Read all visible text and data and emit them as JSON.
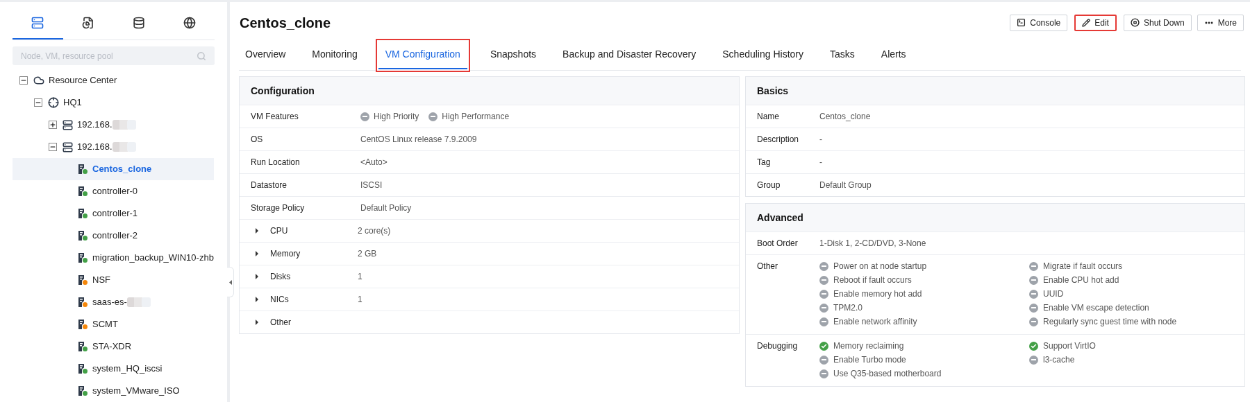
{
  "sidebar": {
    "view_tabs": [
      {
        "kind": "server",
        "selected": true
      },
      {
        "kind": "document",
        "selected": false
      },
      {
        "kind": "database",
        "selected": false
      },
      {
        "kind": "globe",
        "selected": false
      }
    ],
    "search": {
      "placeholder": "Node, VM, resource pool"
    },
    "tree": [
      {
        "kind": "center",
        "label": "Resource Center",
        "expanded": true,
        "selected": false,
        "children": [
          {
            "kind": "site",
            "label": "HQ1",
            "expanded": true,
            "selected": false,
            "children": [
              {
                "kind": "host",
                "label": "192.168.",
                "redacted": true,
                "expanded": false,
                "selected": false
              },
              {
                "kind": "host",
                "label": "192.168.",
                "redacted": true,
                "expanded": true,
                "selected": false,
                "children": [
                  {
                    "kind": "vm",
                    "label": "Centos_clone",
                    "color": "#43a047",
                    "selected": true
                  },
                  {
                    "kind": "vm",
                    "label": "controller-0",
                    "color": "#43a047",
                    "selected": false
                  },
                  {
                    "kind": "vm",
                    "label": "controller-1",
                    "color": "#43a047",
                    "selected": false
                  },
                  {
                    "kind": "vm",
                    "label": "controller-2",
                    "color": "#43a047",
                    "selected": false
                  },
                  {
                    "kind": "vm",
                    "label": "migration_backup_WIN10-zhb",
                    "color": "#43a047",
                    "selected": false
                  },
                  {
                    "kind": "vm",
                    "label": "NSF",
                    "color": "#f5870a",
                    "selected": false
                  },
                  {
                    "kind": "vm",
                    "label": "saas-es-",
                    "redacted": true,
                    "color": "#f5870a",
                    "selected": false
                  },
                  {
                    "kind": "vm",
                    "label": "SCMT",
                    "color": "#f5870a",
                    "selected": false
                  },
                  {
                    "kind": "vm",
                    "label": "STA-XDR",
                    "color": "#43a047",
                    "selected": false
                  },
                  {
                    "kind": "vm",
                    "label": "system_HQ_iscsi",
                    "color": "#43a047",
                    "selected": false
                  },
                  {
                    "kind": "vm",
                    "label": "system_VMware_ISO",
                    "color": "#43a047",
                    "selected": false
                  }
                ]
              }
            ]
          }
        ]
      }
    ]
  },
  "header": {
    "title": "Centos_clone",
    "actions": [
      {
        "kind": "console",
        "label": "Console",
        "highlighted": false
      },
      {
        "kind": "edit",
        "label": "Edit",
        "highlighted": true
      },
      {
        "kind": "shutdown",
        "label": "Shut Down",
        "highlighted": false
      },
      {
        "kind": "more",
        "label": "More",
        "highlighted": false
      }
    ],
    "tabs": [
      {
        "label": "Overview",
        "selected": false,
        "highlighted": false
      },
      {
        "label": "Monitoring",
        "selected": false,
        "highlighted": false
      },
      {
        "label": "VM Configuration",
        "selected": true,
        "highlighted": true
      },
      {
        "label": "Snapshots",
        "selected": false,
        "highlighted": false
      },
      {
        "label": "Backup and Disaster Recovery",
        "selected": false,
        "highlighted": false
      },
      {
        "label": "Scheduling History",
        "selected": false,
        "highlighted": false
      },
      {
        "label": "Tasks",
        "selected": false,
        "highlighted": false
      },
      {
        "label": "Alerts",
        "selected": false,
        "highlighted": false
      }
    ]
  },
  "configuration": {
    "title": "Configuration",
    "rows": [
      {
        "kind": "features",
        "label": "VM Features",
        "features": [
          {
            "label": "High Priority",
            "enabled": false
          },
          {
            "label": "High Performance",
            "enabled": false
          }
        ]
      },
      {
        "kind": "text",
        "label": "OS",
        "value": "CentOS Linux release 7.9.2009"
      },
      {
        "kind": "text",
        "label": "Run Location",
        "value": "<Auto>"
      },
      {
        "kind": "text",
        "label": "Datastore",
        "value": "ISCSI"
      },
      {
        "kind": "text",
        "label": "Storage Policy",
        "value": "Default Policy"
      },
      {
        "kind": "expandable",
        "label": "CPU",
        "value": "2 core(s)",
        "expanded": false
      },
      {
        "kind": "expandable",
        "label": "Memory",
        "value": "2 GB",
        "expanded": false
      },
      {
        "kind": "expandable",
        "label": "Disks",
        "value": "1",
        "expanded": false
      },
      {
        "kind": "expandable",
        "label": "NICs",
        "value": "1",
        "expanded": false
      },
      {
        "kind": "expandable",
        "label": "Other",
        "expanded": false
      }
    ]
  },
  "basics": {
    "title": "Basics",
    "rows": [
      {
        "kind": "text",
        "label": "Name",
        "value": "Centos_clone"
      },
      {
        "kind": "text",
        "label": "Description",
        "value": "-"
      },
      {
        "kind": "text",
        "label": "Tag",
        "value": "-"
      },
      {
        "kind": "text",
        "label": "Group",
        "value": "Default Group"
      }
    ]
  },
  "advanced": {
    "title": "Advanced",
    "rows": [
      {
        "kind": "text",
        "label": "Boot Order",
        "value": "1-Disk 1, 2-CD/DVD, 3-None"
      },
      {
        "kind": "options",
        "label": "Other",
        "options": [
          {
            "label": "Power on at node startup",
            "enabled": false
          },
          {
            "label": "Migrate if fault occurs",
            "enabled": false
          },
          {
            "label": "Reboot if fault occurs",
            "enabled": false
          },
          {
            "label": "Enable CPU hot add",
            "enabled": false
          },
          {
            "label": "Enable memory hot add",
            "enabled": false
          },
          {
            "label": "UUID",
            "enabled": false
          },
          {
            "label": "TPM2.0",
            "enabled": false
          },
          {
            "label": "Enable VM escape detection",
            "enabled": false
          },
          {
            "label": "Enable network affinity",
            "enabled": false
          },
          {
            "label": "Regularly sync guest time with node",
            "enabled": false
          }
        ]
      },
      {
        "kind": "options",
        "label": "Debugging",
        "options": [
          {
            "label": "Memory reclaiming",
            "enabled": true
          },
          {
            "label": "Support VirtIO",
            "enabled": true
          },
          {
            "label": "Enable Turbo mode",
            "enabled": false
          },
          {
            "label": "l3-cache",
            "enabled": false
          },
          {
            "label": "Use Q35-based motherboard",
            "enabled": false
          }
        ]
      }
    ]
  }
}
